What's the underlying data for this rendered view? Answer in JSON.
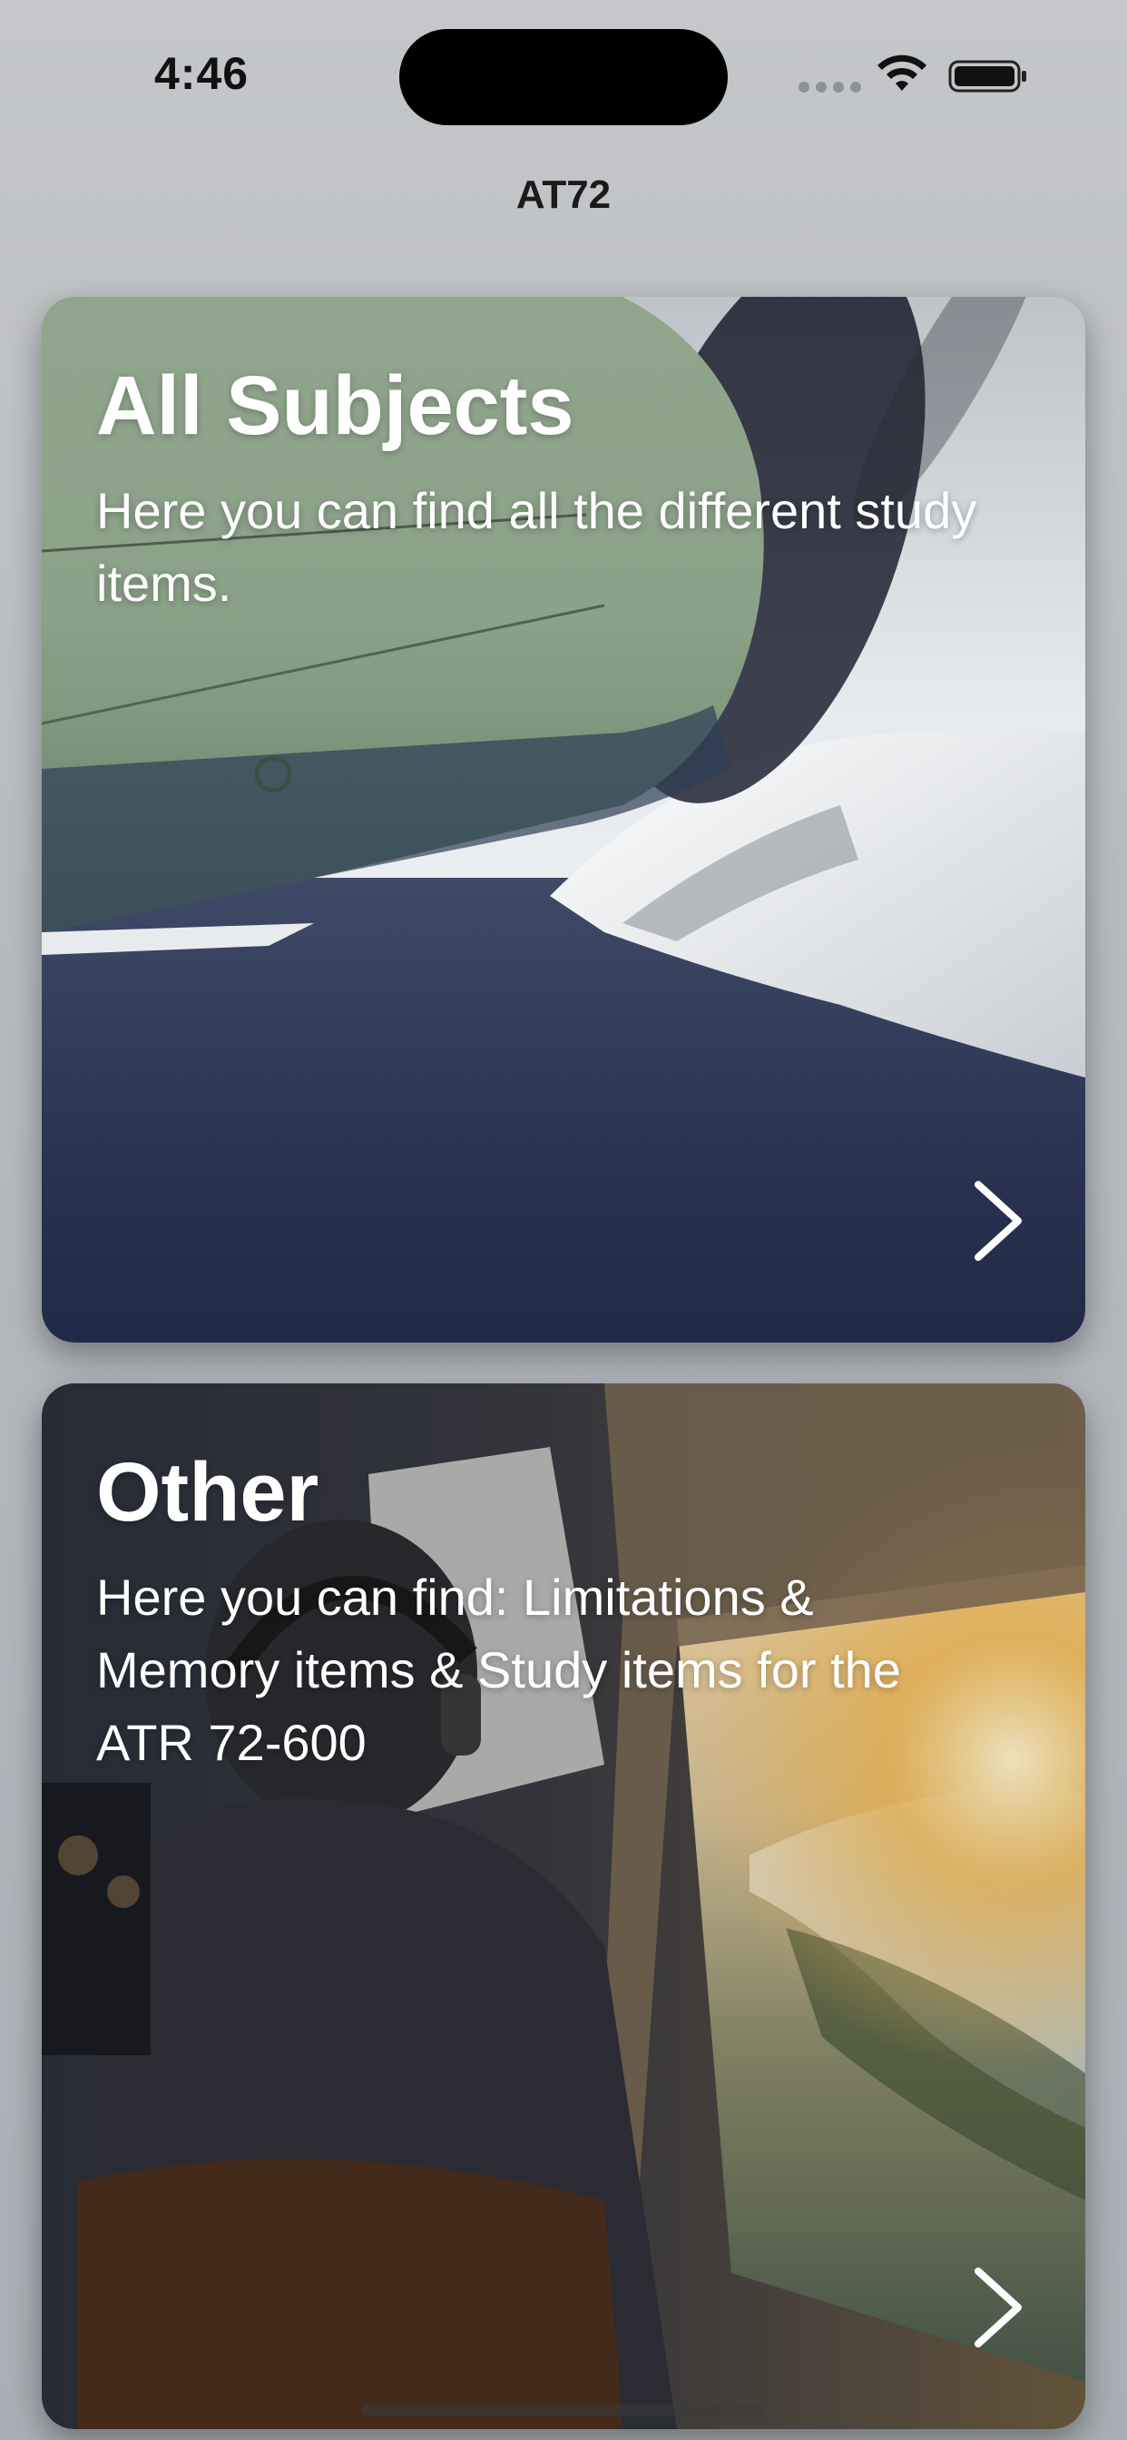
{
  "status_bar": {
    "time": "4:46",
    "icons": [
      "signal-dots-icon",
      "wifi-icon",
      "battery-icon"
    ]
  },
  "nav": {
    "title": "AT72"
  },
  "cards": [
    {
      "title": "All Subjects",
      "description": "Here you can find all the different study items.",
      "image": "propeller-aircraft-over-snowy-fjord",
      "action_icon": "chevron-right-icon"
    },
    {
      "title": "Other",
      "description": "Here you can find: Limitations & Memory items & Study items for the ATR 72-600",
      "image": "pilot-in-cockpit-at-sunset",
      "action_icon": "chevron-right-icon"
    }
  ],
  "colors": {
    "background": "#b9bdc2",
    "text_primary": "#1a1a1a",
    "card_text": "#ffffff"
  }
}
